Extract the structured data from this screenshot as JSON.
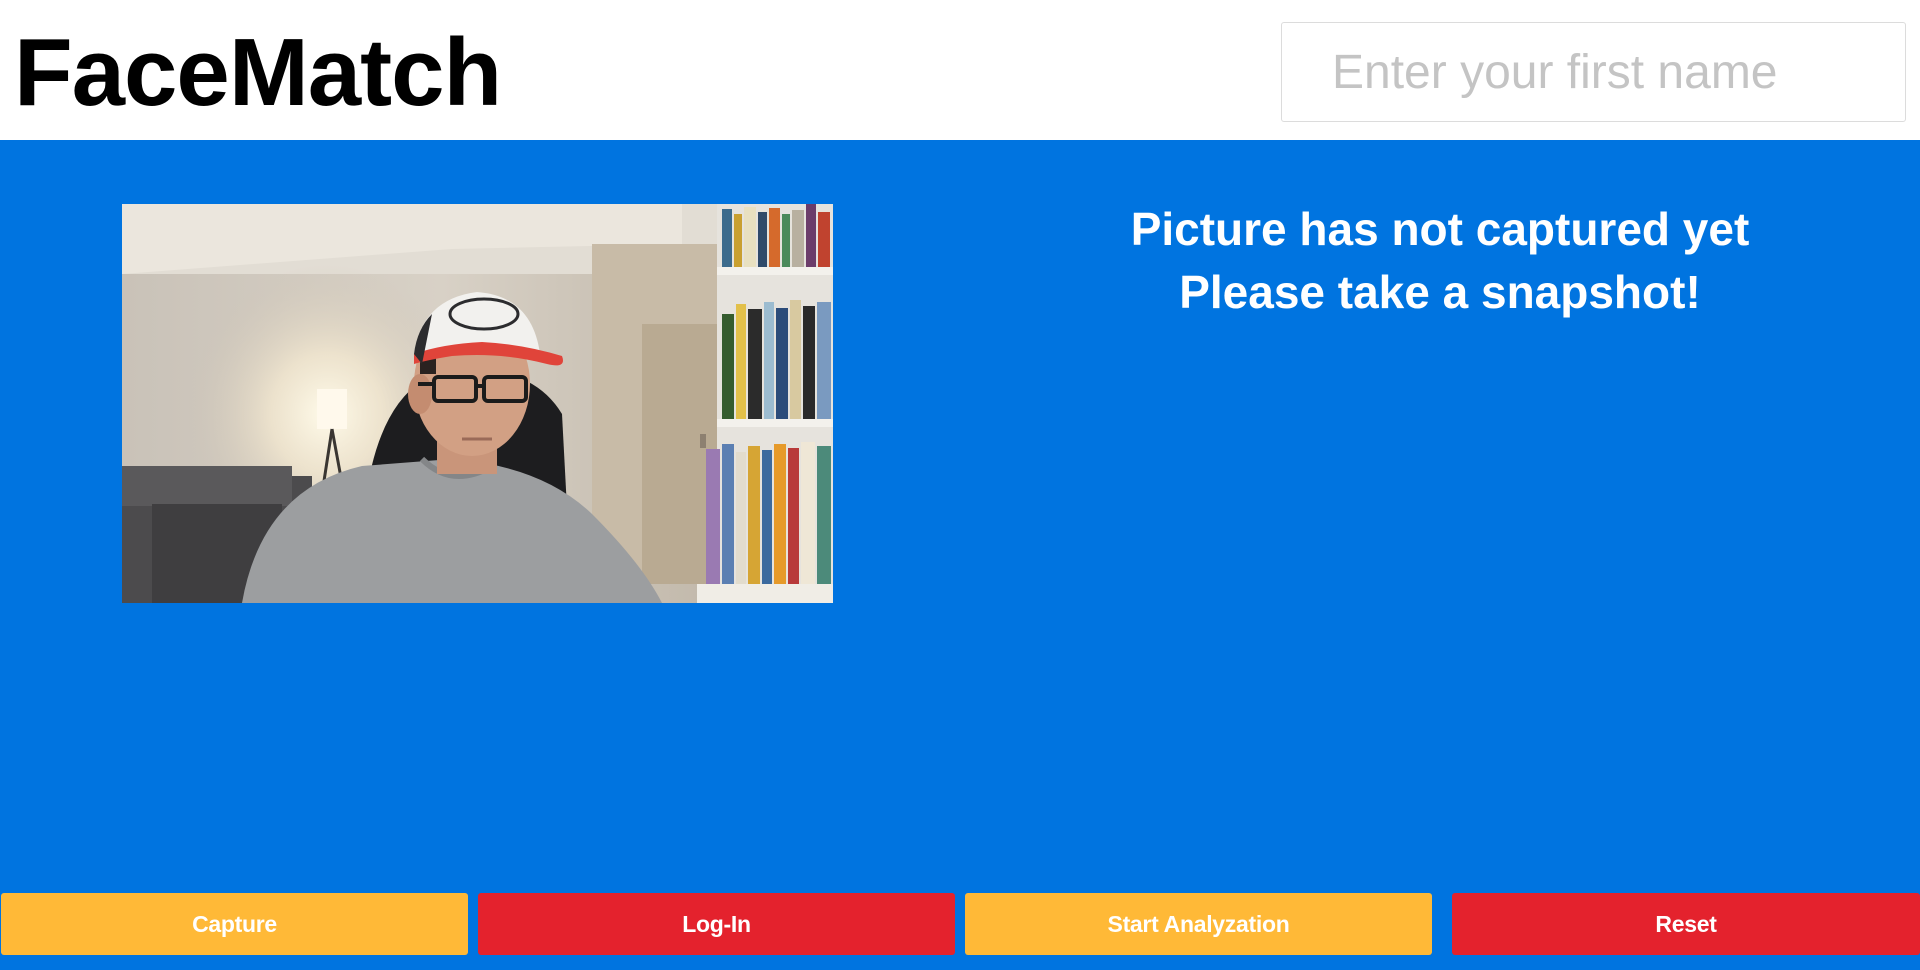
{
  "app": {
    "title": "FaceMatch"
  },
  "name_input": {
    "placeholder": "Enter your first name",
    "value": ""
  },
  "webcam": {
    "description": "live-webcam-feed"
  },
  "status": {
    "line1": "Picture has not captured yet",
    "line2": "Please take a snapshot!"
  },
  "toolbar": {
    "capture_label": "Capture",
    "login_label": "Log-In",
    "analyze_label": "Start Analyzation",
    "reset_label": "Reset"
  },
  "colors": {
    "main_bg": "#0074e0",
    "header_bg": "#ffffff",
    "button_yellow": "#ffb937",
    "button_red": "#e4222d"
  }
}
